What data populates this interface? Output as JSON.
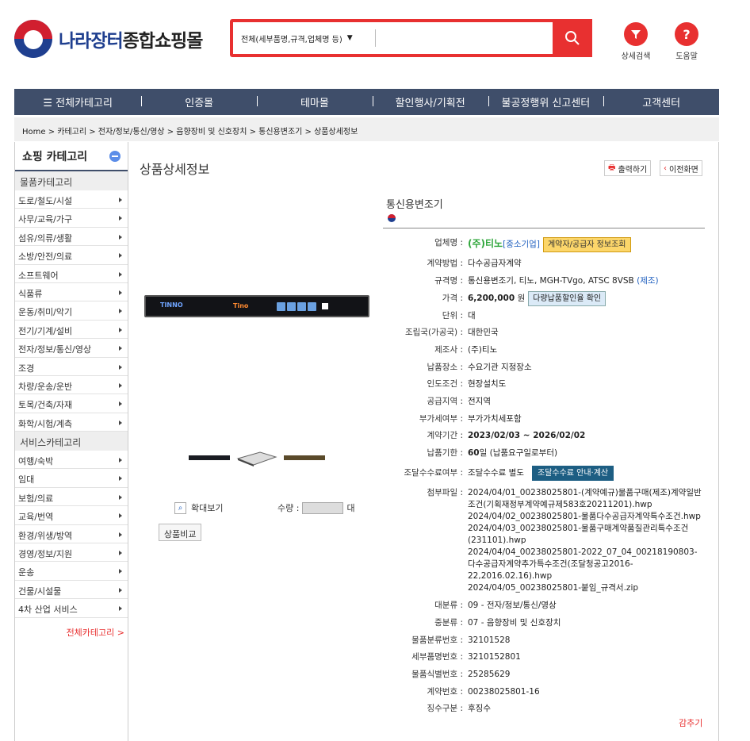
{
  "header": {
    "logo_blue": "나라장터",
    "logo_dark": "종합쇼핑몰",
    "search_select": "전체(세부품명,규격,업체명 등)",
    "search_value": "",
    "detail_search": "상세검색",
    "help": "도움말"
  },
  "nav": {
    "items": [
      "전체카테고리",
      "인증몰",
      "테마몰",
      "할인행사/기획전",
      "불공정행위 신고센터",
      "고객센터"
    ]
  },
  "breadcrumb": "Home > 카테고리 > 전자/정보/통신/영상 > 음향장비 및 신호장치 > 통신용변조기 > 상품상세정보",
  "sidebar": {
    "title": "쇼핑 카테고리",
    "section1": "물품카테고리",
    "items1": [
      "도로/철도/시설",
      "사무/교육/가구",
      "섬유/의류/생활",
      "소방/안전/의료",
      "소프트웨어",
      "식품류",
      "운동/취미/악기",
      "전기/기계/설비",
      "전자/정보/통신/영상",
      "조경",
      "차량/운송/운반",
      "토목/건축/자재",
      "화학/시험/계측"
    ],
    "section2": "서비스카테고리",
    "items2": [
      "여행/숙박",
      "임대",
      "보험/의료",
      "교육/번역",
      "환경/위생/방역",
      "경영/정보/지원",
      "운송",
      "건물/시설물",
      "4차 산업 서비스"
    ],
    "all_link": "전체카테고리 >"
  },
  "main": {
    "title": "상품상세정보",
    "print": "출력하기",
    "back": "이전화면",
    "zoom": "확대보기",
    "qty_label": "수량 :",
    "qty_value": "",
    "qty_unit": "대",
    "compare": "상품비교",
    "product_name": "통신용변조기",
    "collapse": "감추기"
  },
  "spec": {
    "company_label": "업체명 :",
    "company": "(주)티노",
    "company_tag": "[중소기업]",
    "company_btn": "계약자/공급자 정보조회",
    "method_label": "계약방법 :",
    "method": "다수공급자계약",
    "model_label": "규격명 :",
    "model": "통신용변조기, 티노, MGH-TVgo, ATSC 8VSB",
    "model_tag": "(제조)",
    "price_label": "가격 :",
    "price": "6,200,000",
    "price_unit": "원",
    "price_btn": "다량납품할인율 확인",
    "unit_label": "단위 :",
    "unit": "대",
    "origin_label": "조립국(가공국) :",
    "origin": "대한민국",
    "maker_label": "제조사 :",
    "maker": "(주)티노",
    "place_label": "납품장소 :",
    "place": "수요기관 지정장소",
    "delivery_label": "인도조건 :",
    "delivery": "현장설치도",
    "area_label": "공급지역 :",
    "area": "전지역",
    "vat_label": "부가세여부 :",
    "vat": "부가가치세포함",
    "period_label": "계약기간 :",
    "period": "2023/02/03 ~ 2026/02/02",
    "deadline_label": "납품기한 :",
    "deadline_days": "60",
    "deadline_rest": "일 (납품요구일로부터)",
    "fee_label": "조달수수료여부 :",
    "fee": "조달수수료 별도",
    "fee_btn": "조달수수료 안내·계산",
    "files_label": "첨부파일 :",
    "files": [
      "2024/04/01_00238025801-(계약예규)물품구매(제조)계약일반조건(기획재정부계약예규제583호20211201).hwp",
      "2024/04/02_00238025801-물품다수공급자계약특수조건.hwp",
      "2024/04/03_00238025801-물품구매계약품질관리특수조건(231101).hwp",
      "2024/04/04_00238025801-2022_07_04_00218190803-다수공급자계약추가특수조건(조달청공고2016-22,2016.02.16).hwp",
      "2024/04/05_00238025801-붙임_규격서.zip"
    ],
    "cat_large_label": "대분류 :",
    "cat_large": "09 - 전자/정보/통신/영상",
    "cat_mid_label": "중분류 :",
    "cat_mid": "07 - 음향장비 및 신호장치",
    "class_no_label": "물품분류번호 :",
    "class_no": "32101528",
    "detail_no_label": "세부품명번호 :",
    "detail_no": "3210152801",
    "id_no_label": "물품식별번호 :",
    "id_no": "25285629",
    "contract_no_label": "계약번호 :",
    "contract_no": "00238025801-16",
    "tax_label": "징수구분 :",
    "tax": "후징수"
  },
  "colors": {
    "accent": "#e83030",
    "nav_bg": "#3f4e6a",
    "link": "#1f5fbf"
  }
}
